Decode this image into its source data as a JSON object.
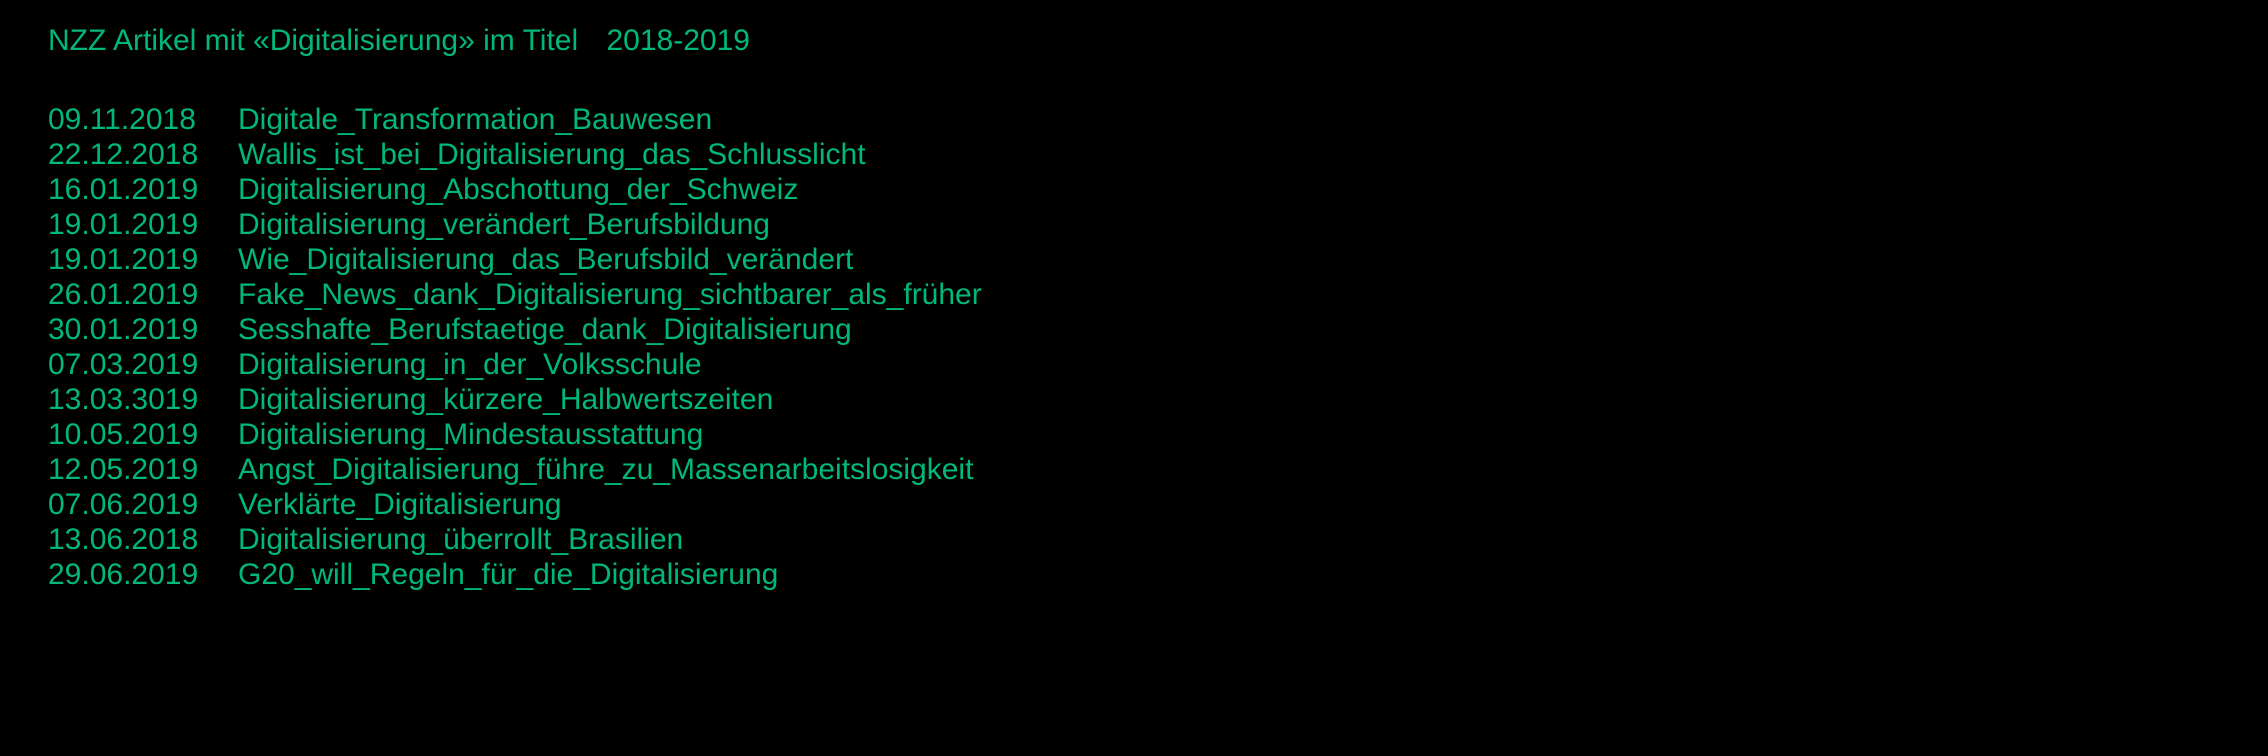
{
  "header": {
    "main": "NZZ Artikel mit «Digitalisierung» im Titel",
    "range": "2018-2019"
  },
  "articles": [
    {
      "date": "09.11.2018",
      "title": "Digitale_Transformation_Bauwesen"
    },
    {
      "date": "22.12.2018",
      "title": "Wallis_ist_bei_Digitalisierung_das_Schlusslicht"
    },
    {
      "date": "16.01.2019",
      "title": "Digitalisierung_Abschottung_der_Schweiz"
    },
    {
      "date": "19.01.2019",
      "title": "Digitalisierung_verändert_Berufsbildung"
    },
    {
      "date": "19.01.2019",
      "title": "Wie_Digitalisierung_das_Berufsbild_verändert"
    },
    {
      "date": "26.01.2019",
      "title": "Fake_News_dank_Digitalisierung_sichtbarer_als_früher"
    },
    {
      "date": "30.01.2019",
      "title": "Sesshafte_Berufstaetige_dank_Digitalisierung"
    },
    {
      "date": "07.03.2019",
      "title": "Digitalisierung_in_der_Volksschule"
    },
    {
      "date": "13.03.3019",
      "title": "Digitalisierung_kürzere_Halbwertszeiten"
    },
    {
      "date": "10.05.2019",
      "title": "Digitalisierung_Mindestausstattung"
    },
    {
      "date": "12.05.2019",
      "title": "Angst_Digitalisierung_führe_zu_Massenarbeitslosigkeit"
    },
    {
      "date": "07.06.2019",
      "title": "Verklärte_Digitalisierung"
    },
    {
      "date": "13.06.2018",
      "title": "Digitalisierung_überrollt_Brasilien"
    },
    {
      "date": "29.06.2019",
      "title": "G20_will_Regeln_für_die_Digitalisierung"
    }
  ]
}
